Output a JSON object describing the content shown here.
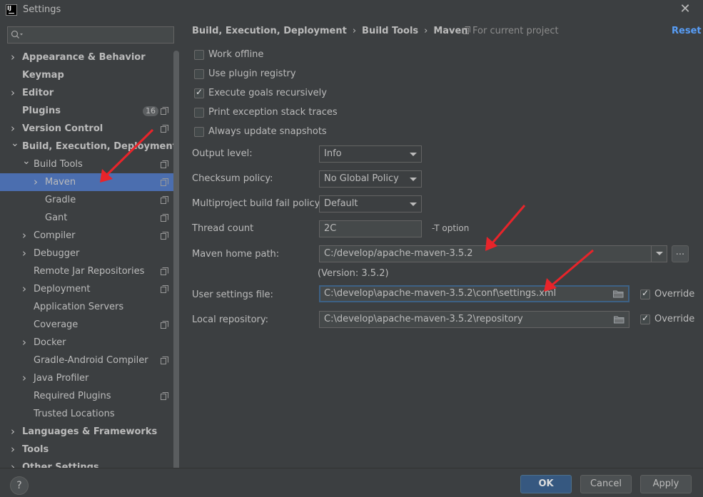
{
  "window": {
    "title": "Settings",
    "app_icon_text": "IJ",
    "close_icon": "close-icon"
  },
  "sidebar": {
    "search": {
      "placeholder": "",
      "value": ""
    },
    "badge_plugins": "16",
    "items": [
      {
        "label": "Appearance & Behavior",
        "bold": true,
        "level": 0,
        "arrow": "collapsed",
        "copy": false
      },
      {
        "label": "Keymap",
        "bold": true,
        "level": 0,
        "arrow": "none",
        "copy": false
      },
      {
        "label": "Editor",
        "bold": true,
        "level": 0,
        "arrow": "collapsed",
        "copy": false
      },
      {
        "label": "Plugins",
        "bold": true,
        "level": 0,
        "arrow": "none",
        "copy": true
      },
      {
        "label": "Version Control",
        "bold": true,
        "level": 0,
        "arrow": "collapsed",
        "copy": true
      },
      {
        "label": "Build, Execution, Deployment",
        "bold": true,
        "level": 0,
        "arrow": "expanded",
        "copy": false
      },
      {
        "label": "Build Tools",
        "bold": false,
        "level": 1,
        "arrow": "expanded",
        "copy": true
      },
      {
        "label": "Maven",
        "bold": false,
        "level": 2,
        "arrow": "collapsed",
        "copy": true,
        "selected": true
      },
      {
        "label": "Gradle",
        "bold": false,
        "level": 2,
        "arrow": "none",
        "copy": true
      },
      {
        "label": "Gant",
        "bold": false,
        "level": 2,
        "arrow": "none",
        "copy": true
      },
      {
        "label": "Compiler",
        "bold": false,
        "level": 1,
        "arrow": "collapsed",
        "copy": true
      },
      {
        "label": "Debugger",
        "bold": false,
        "level": 1,
        "arrow": "collapsed",
        "copy": false
      },
      {
        "label": "Remote Jar Repositories",
        "bold": false,
        "level": 1,
        "arrow": "none",
        "copy": true
      },
      {
        "label": "Deployment",
        "bold": false,
        "level": 1,
        "arrow": "collapsed",
        "copy": true
      },
      {
        "label": "Application Servers",
        "bold": false,
        "level": 1,
        "arrow": "none",
        "copy": false
      },
      {
        "label": "Coverage",
        "bold": false,
        "level": 1,
        "arrow": "none",
        "copy": true
      },
      {
        "label": "Docker",
        "bold": false,
        "level": 1,
        "arrow": "collapsed",
        "copy": false
      },
      {
        "label": "Gradle-Android Compiler",
        "bold": false,
        "level": 1,
        "arrow": "none",
        "copy": true
      },
      {
        "label": "Java Profiler",
        "bold": false,
        "level": 1,
        "arrow": "collapsed",
        "copy": false
      },
      {
        "label": "Required Plugins",
        "bold": false,
        "level": 1,
        "arrow": "none",
        "copy": true
      },
      {
        "label": "Trusted Locations",
        "bold": false,
        "level": 1,
        "arrow": "none",
        "copy": false
      },
      {
        "label": "Languages & Frameworks",
        "bold": true,
        "level": 0,
        "arrow": "collapsed",
        "copy": false
      },
      {
        "label": "Tools",
        "bold": true,
        "level": 0,
        "arrow": "collapsed",
        "copy": false
      },
      {
        "label": "Other Settings",
        "bold": true,
        "level": 0,
        "arrow": "collapsed",
        "copy": false
      }
    ]
  },
  "header": {
    "breadcrumb": [
      "Build, Execution, Deployment",
      "Build Tools",
      "Maven"
    ],
    "breadcrumb_sep": "›",
    "scope": "For current project",
    "reset": "Reset"
  },
  "checkboxes": [
    {
      "label": "Work offline",
      "checked": false
    },
    {
      "label": "Use plugin registry",
      "checked": false
    },
    {
      "label": "Execute goals recursively",
      "checked": true
    },
    {
      "label": "Print exception stack traces",
      "checked": false
    },
    {
      "label": "Always update snapshots",
      "checked": false
    }
  ],
  "fields": {
    "output_level": {
      "label": "Output level:",
      "value": "Info"
    },
    "checksum_policy": {
      "label": "Checksum policy:",
      "value": "No Global Policy"
    },
    "fail_policy": {
      "label": "Multiproject build fail policy:",
      "value": "Default"
    },
    "thread_count": {
      "label": "Thread count",
      "value": "2C",
      "hint": "-T option"
    },
    "maven_home": {
      "label": "Maven home path:",
      "value": "C:/develop/apache-maven-3.5.2",
      "browse": "...",
      "version": "(Version: 3.5.2)"
    },
    "user_settings": {
      "label": "User settings file:",
      "value": "C:\\develop\\apache-maven-3.5.2\\conf\\settings.xml",
      "override_label": "Override",
      "override": true
    },
    "local_repo": {
      "label": "Local repository:",
      "value": "C:\\develop\\apache-maven-3.5.2\\repository",
      "override_label": "Override",
      "override": true
    }
  },
  "footer": {
    "help": "?",
    "ok": "OK",
    "cancel": "Cancel",
    "apply": "Apply"
  },
  "colors": {
    "background": "#3c3f41",
    "selection": "#4b6eaf",
    "link": "#589df6",
    "primary_button": "#365880",
    "annotation_arrow": "#e8242a"
  }
}
